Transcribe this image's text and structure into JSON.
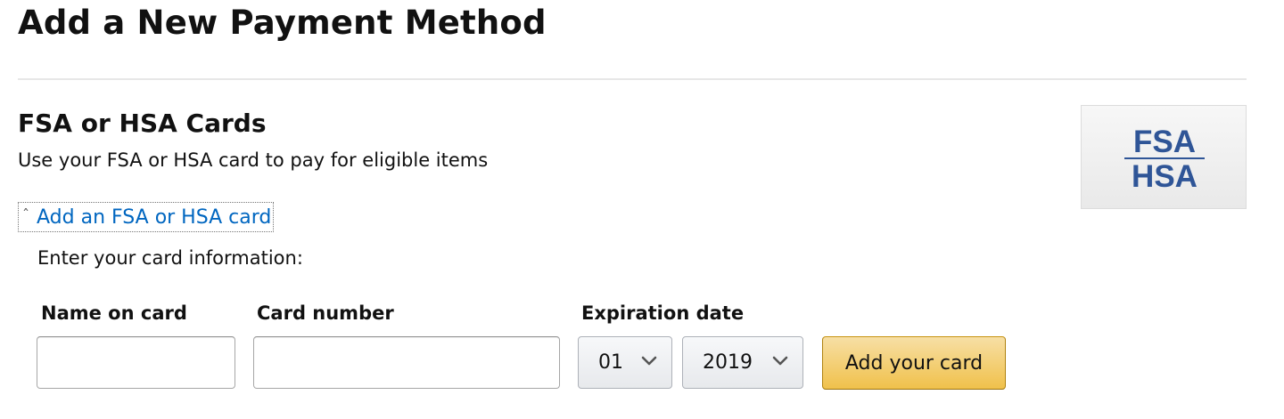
{
  "page": {
    "title": "Add a New Payment Method"
  },
  "section": {
    "title": "FSA or HSA Cards",
    "subtitle": "Use your FSA or HSA card to pay for eligible items",
    "logo": {
      "top_text": "FSA",
      "bottom_text": "HSA",
      "color": "#2f5597"
    }
  },
  "expander": {
    "icon": "caret-up-icon",
    "label": "Add an FSA or HSA card",
    "link_color": "#0066c0"
  },
  "form": {
    "intro": "Enter your card information:",
    "name_label": "Name on card",
    "name_value": "",
    "card_number_label": "Card number",
    "card_number_value": "",
    "expiration_label": "Expiration date",
    "exp_month": "01",
    "exp_year": "2019",
    "submit_label": "Add your card",
    "button_color": "#f0c14b"
  }
}
